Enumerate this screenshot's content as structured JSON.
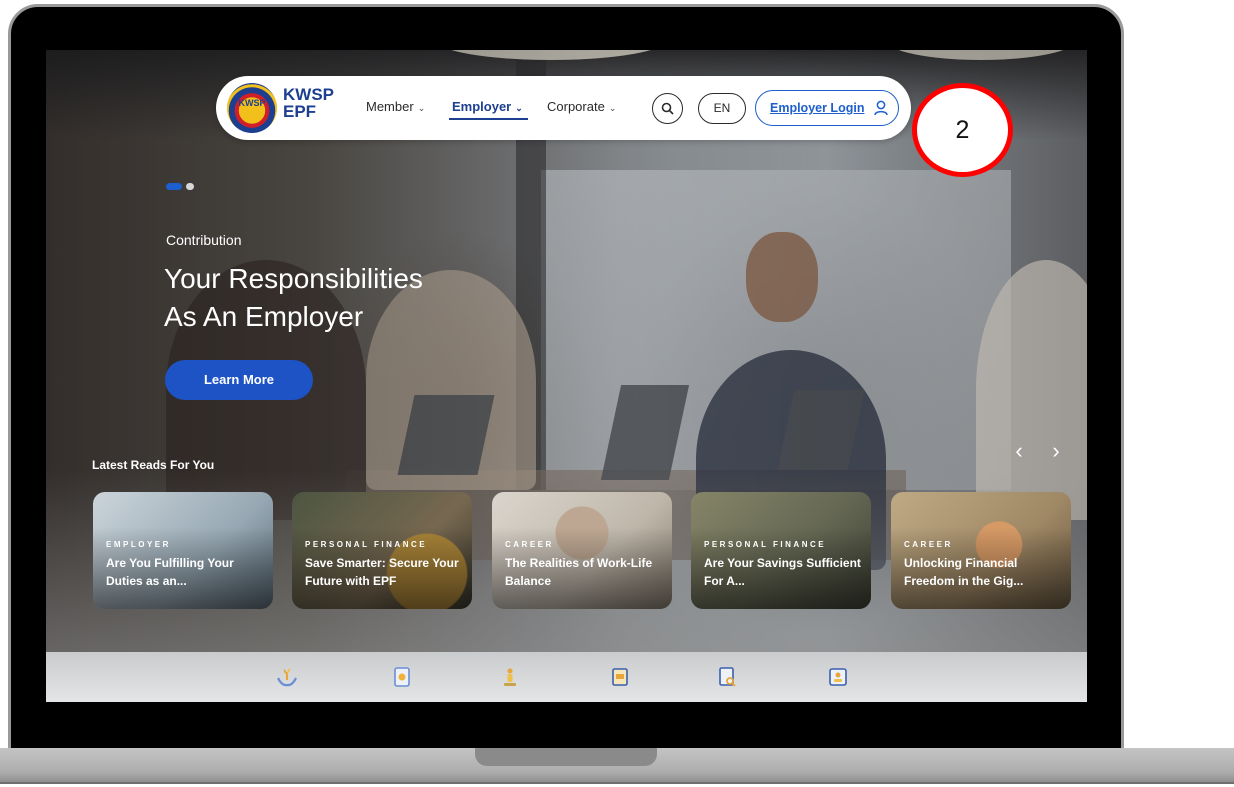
{
  "navbar": {
    "logo_text_line1": "KWSP",
    "logo_text_line2": "EPF",
    "logo_badge_text": "KWSP",
    "menu": [
      {
        "label": "Member",
        "active": false
      },
      {
        "label": "Employer",
        "active": true
      },
      {
        "label": "Corporate",
        "active": false
      }
    ],
    "search_icon": "search-icon",
    "language": "EN",
    "login_label": "Employer Login",
    "login_icon": "user-icon"
  },
  "step_marker": "2",
  "hero": {
    "eyebrow": "Contribution",
    "title_line1": "Your Responsibilities",
    "title_line2": "As An Employer",
    "cta_label": "Learn More",
    "carousel_active_index": 0,
    "carousel_count": 2
  },
  "latest_reads": {
    "title": "Latest Reads For You",
    "prev_icon": "chevron-left-icon",
    "next_icon": "chevron-right-icon",
    "cards": [
      {
        "category": "EMPLOYER",
        "title": "Are You Fulfilling Your Duties as an..."
      },
      {
        "category": "PERSONAL FINANCE",
        "title": "Save Smarter: Secure Your Future with EPF"
      },
      {
        "category": "CAREER",
        "title": "The Realities of Work-Life Balance"
      },
      {
        "category": "PERSONAL FINANCE",
        "title": "Are Your Savings Sufficient For A..."
      },
      {
        "category": "CAREER",
        "title": "Unlocking Financial Freedom in the Gig..."
      }
    ]
  },
  "quick_icons": [
    "hands-plant-icon",
    "document-coin-icon",
    "person-stand-icon",
    "certificate-icon",
    "document-search-icon",
    "id-card-icon"
  ],
  "colors": {
    "brand_blue": "#1d3f8f",
    "link_blue": "#1d5fce",
    "cta_blue": "#1d53c4",
    "marker_red": "#ff0000"
  }
}
